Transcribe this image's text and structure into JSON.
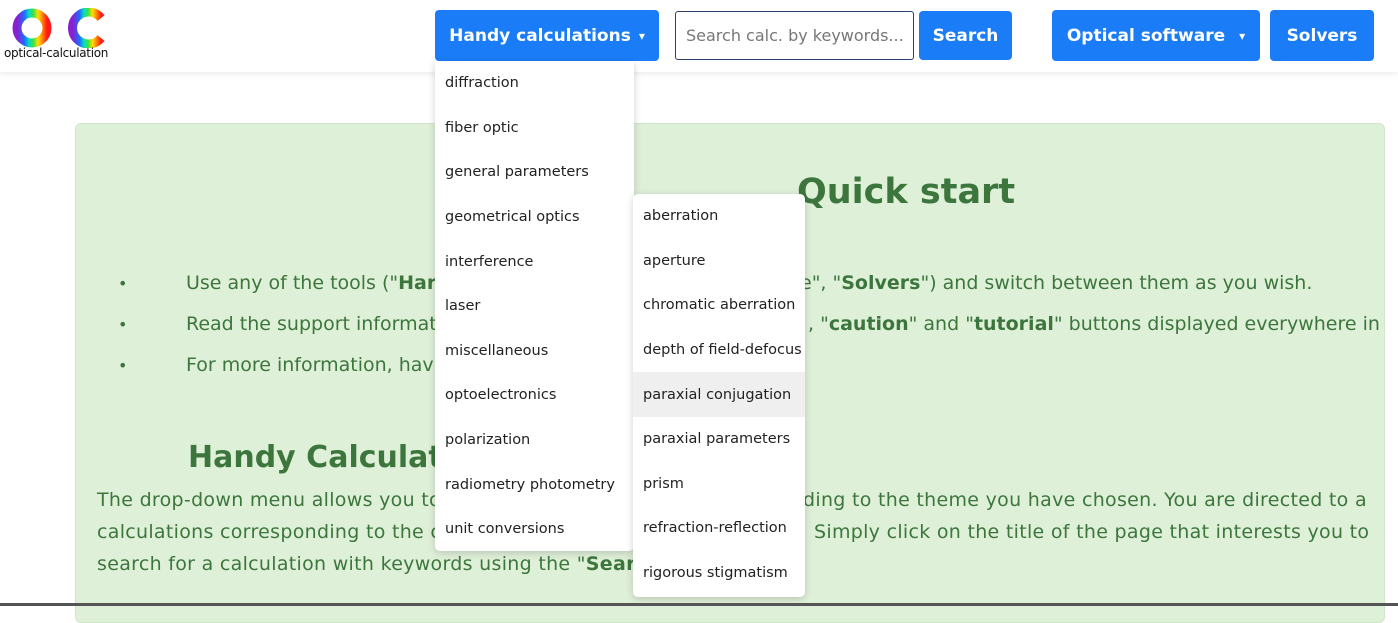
{
  "header": {
    "logo_text": "optical-calculation",
    "handy_button": "Handy calculations",
    "caret": "▾",
    "search_placeholder": "Search calc. by keywords...",
    "search_button": "Search",
    "optical_software_button": "Optical software",
    "solvers_button": "Solvers",
    "accent": "#1a7cf7"
  },
  "main": {
    "quick_start_title": "Quick start",
    "bullets": [
      {
        "left_a": "Use any of the tools (\"",
        "left_b": "Har",
        "right_a": "e\", \"",
        "right_b": "Solvers",
        "right_c": "\") and switch between them as you wish."
      },
      {
        "left_a": "Read the support informat",
        "right_a": ", \"",
        "right_b": "caution",
        "right_c": "\" and \"",
        "right_d": "tutorial",
        "right_e": "\" buttons displayed everywhere in t"
      },
      {
        "left_a": "For more information, hav"
      }
    ],
    "section_title": "Handy Calculat",
    "para": {
      "l1_left": "The drop-down menu allows you to",
      "l1_right": "ding to the theme you have chosen. You are directed to a",
      "l2_left": "calculations corresponding to the c",
      "l2_right": "Simply click on the title of the page that interests you to",
      "l3_left": "search for a calculation with keywords using the \"",
      "l3_bold": "Search"
    },
    "bg_color": "#dff0d8",
    "text_color": "#3c763d"
  },
  "menu": {
    "items": [
      "diffraction",
      "fiber optic",
      "general parameters",
      "geometrical optics",
      "interference",
      "laser",
      "miscellaneous",
      "optoelectronics",
      "polarization",
      "radiometry photometry",
      "unit conversions"
    ],
    "submenu": [
      "aberration",
      "aperture",
      "chromatic aberration",
      "depth of field-defocus",
      "paraxial conjugation",
      "paraxial parameters",
      "prism",
      "refraction-reflection",
      "rigorous stigmatism"
    ],
    "highlighted": "paraxial conjugation"
  }
}
